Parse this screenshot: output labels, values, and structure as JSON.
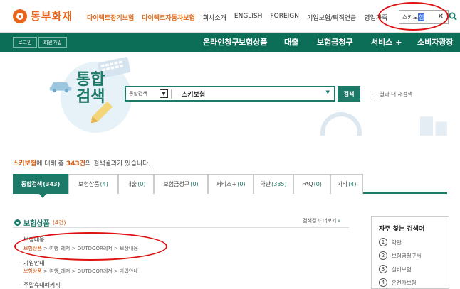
{
  "brand": {
    "name": "동부화재",
    "color": "#e8641b"
  },
  "header": {
    "links": [
      {
        "label": "다이렉트장기보험",
        "style": "orange"
      },
      {
        "label": "다이렉트자동차보험",
        "style": "orange"
      },
      {
        "label": "회사소개",
        "style": "dark"
      },
      {
        "label": "ENGLISH",
        "style": "dark"
      },
      {
        "label": "FOREIGN",
        "style": "dark"
      },
      {
        "label": "기업보험/퇴직연금",
        "style": "dark"
      },
      {
        "label": "영업가족",
        "style": "dark"
      }
    ],
    "search": {
      "value_prefix": "스키보",
      "value_selected": "험",
      "clear_icon": "close-icon",
      "search_icon": "search-icon"
    }
  },
  "nav": {
    "login_label": "로그인",
    "signup_label": "회원가입",
    "items": [
      "온라인창구",
      "보험상품",
      "대출",
      "보험금청구",
      "서비스 +",
      "소비자광장"
    ]
  },
  "hero": {
    "title_line1": "통합",
    "title_line2": "검색",
    "category": "통합검색",
    "query": "스키보험",
    "search_button": "검색",
    "research_label": "결과 내 재검색"
  },
  "summary": {
    "keyword": "스키보험",
    "text1": "에 대해 총 ",
    "count": "343건",
    "text2": "의 검색결과가 있습니다."
  },
  "tabs": [
    {
      "label": "통합검색",
      "count": "(343)",
      "active": true
    },
    {
      "label": "보험상품",
      "count": "(4)",
      "active": false
    },
    {
      "label": "대출",
      "count": "(0)",
      "active": false
    },
    {
      "label": "보험금청구",
      "count": "(0)",
      "active": false
    },
    {
      "label": "서비스+",
      "count": "(0)",
      "active": false
    },
    {
      "label": "약관",
      "count": "(335)",
      "active": false
    },
    {
      "label": "FAQ",
      "count": "(0)",
      "active": false
    },
    {
      "label": "기타",
      "count": "(4)",
      "active": false
    }
  ],
  "results": {
    "section_title": "보험상품",
    "section_count": "(4건)",
    "more_label": "검색결과 더보기",
    "items": [
      {
        "title": "보장내용",
        "path_hl": "보험상품",
        "path_rest": " > 여행_레저 > OUTDOOR레저 > 보장내용"
      },
      {
        "title": "가입안내",
        "path_hl": "보험상품",
        "path_rest": " > 여행_레저 > OUTDOOR레저 > 가입안내"
      },
      {
        "title": "주말휴대폐키지",
        "path_hl": "",
        "path_rest": ""
      }
    ]
  },
  "sidebar": {
    "title": "자주 찾는 검색어",
    "items": [
      {
        "num": "1",
        "label": "약관"
      },
      {
        "num": "2",
        "label": "보험금청구서"
      },
      {
        "num": "3",
        "label": "실비보험"
      },
      {
        "num": "4",
        "label": "운전자보험"
      }
    ]
  },
  "colors": {
    "primary": "#1d7a68",
    "nav": "#0d6e58",
    "accent": "#d4570e",
    "annotation": "#dd1111"
  }
}
